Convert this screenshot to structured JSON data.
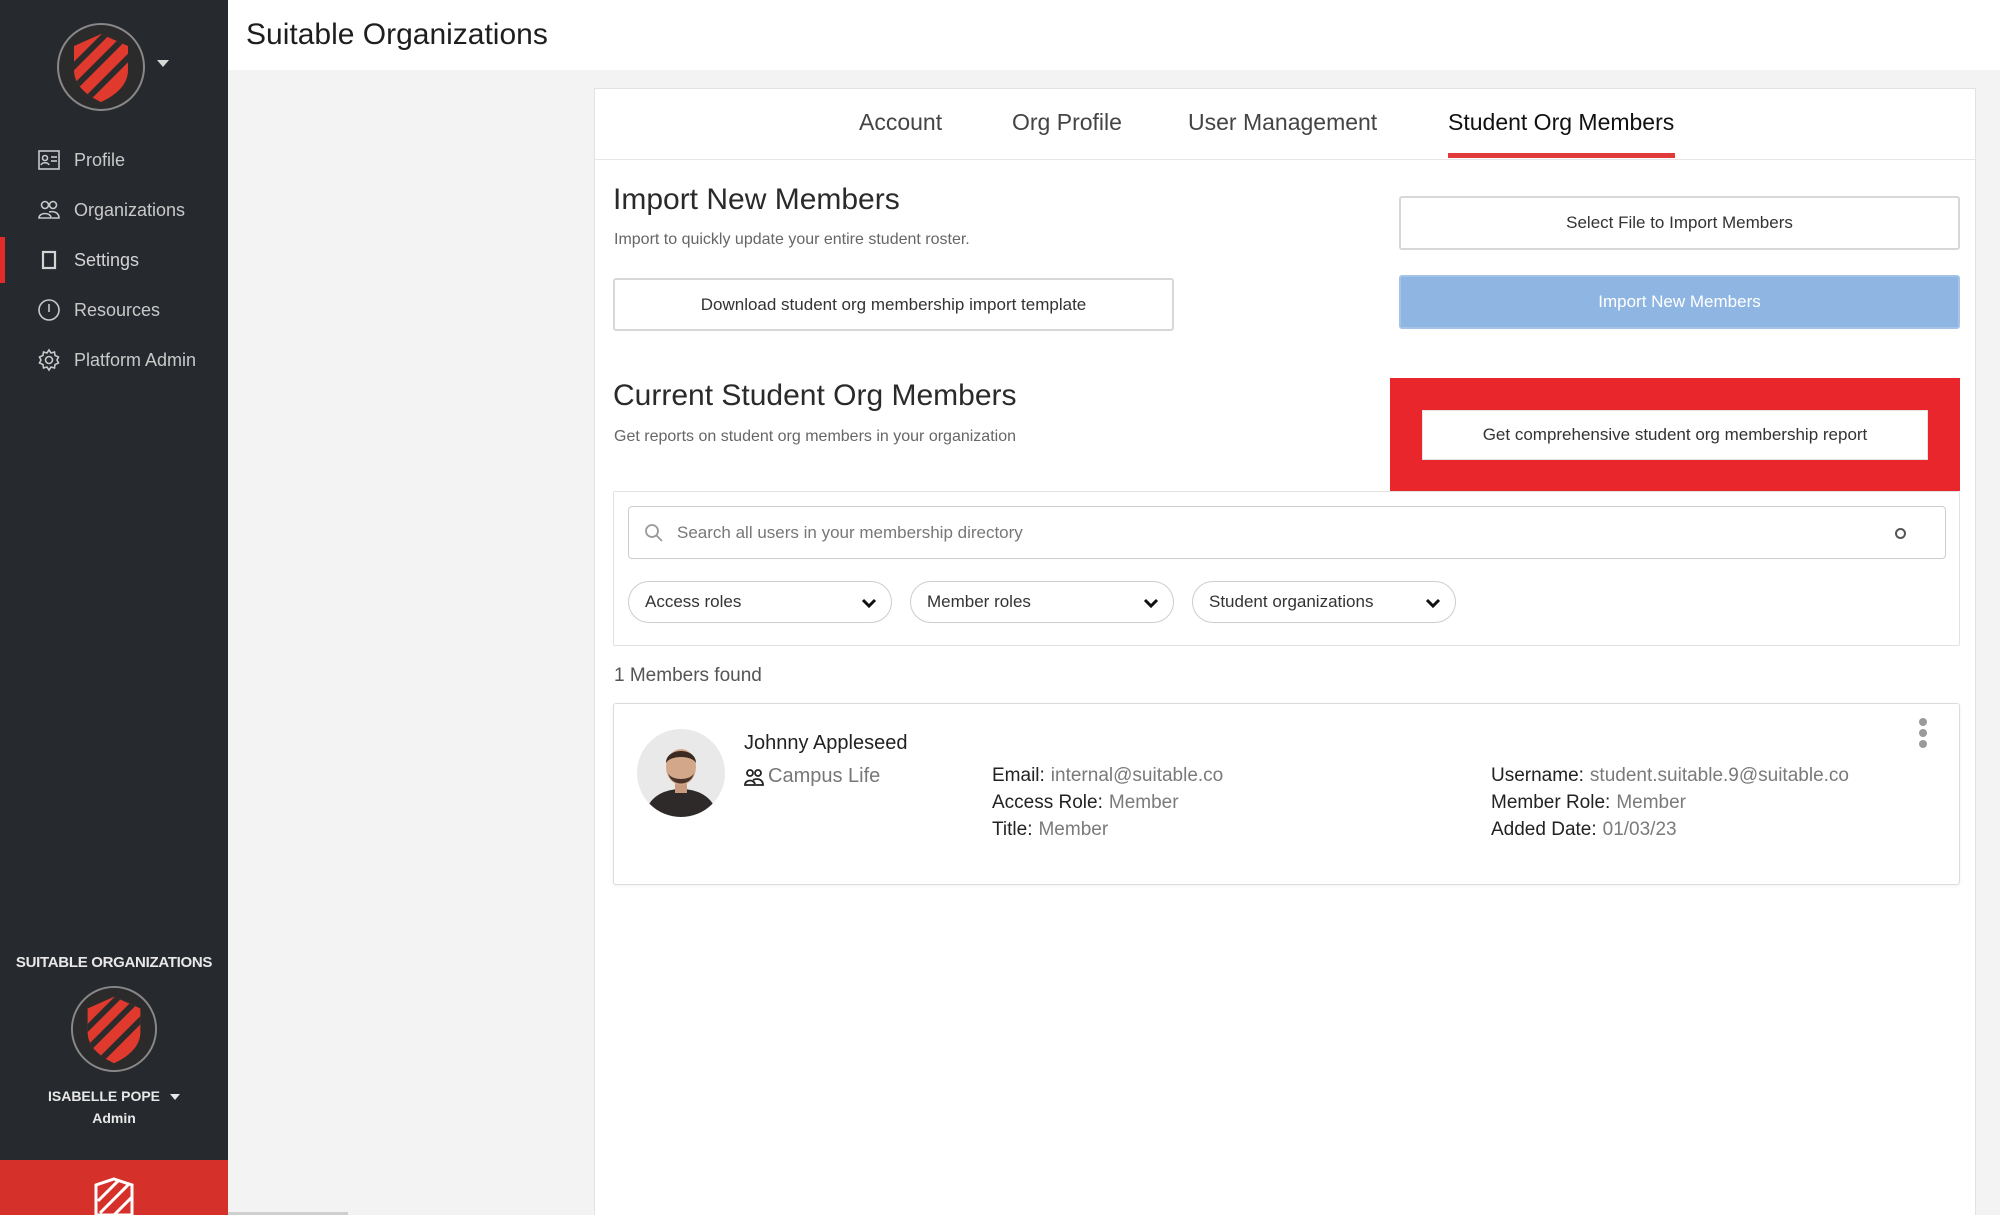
{
  "app": {
    "page_title": "Suitable Organizations",
    "brand_color": "#e32b2b"
  },
  "sidebar": {
    "items": [
      {
        "label": "Profile",
        "icon": "id-card-icon"
      },
      {
        "label": "Organizations",
        "icon": "users-icon"
      },
      {
        "label": "Settings",
        "icon": "settings-square-icon",
        "active": true
      },
      {
        "label": "Resources",
        "icon": "info-circle-icon"
      },
      {
        "label": "Platform Admin",
        "icon": "gear-icon"
      }
    ],
    "org_label": "SUITABLE ORGANIZATIONS",
    "user_name": "ISABELLE POPE",
    "user_role": "Admin"
  },
  "tabs": [
    {
      "label": "Account"
    },
    {
      "label": "Org Profile"
    },
    {
      "label": "User Management"
    },
    {
      "label": "Student Org Members",
      "active": true
    }
  ],
  "import": {
    "title": "Import New Members",
    "subtitle": "Import to quickly update your entire student roster.",
    "template_button": "Download student org membership import template",
    "select_file_button": "Select File to Import Members",
    "import_button": "Import New Members",
    "import_button_color": "#8fb6e3"
  },
  "current": {
    "title": "Current Student Org Members",
    "subtitle": "Get reports on student org members in your organization",
    "report_button": "Get comprehensive student org membership report",
    "highlight_color": "#e8262b"
  },
  "search": {
    "placeholder": "Search all users in your membership directory"
  },
  "filters": [
    {
      "label": "Access roles"
    },
    {
      "label": "Member roles"
    },
    {
      "label": "Student organizations"
    }
  ],
  "results": {
    "count_text": "1 Members found"
  },
  "member": {
    "name": "Johnny Appleseed",
    "org": "Campus Life",
    "email_label": "Email:",
    "email": "internal@suitable.co",
    "access_role_label": "Access Role:",
    "access_role": "Member",
    "title_label": "Title:",
    "title": "Member",
    "username_label": "Username:",
    "username": "student.suitable.9@suitable.co",
    "member_role_label": "Member Role:",
    "member_role": "Member",
    "added_date_label": "Added Date:",
    "added_date": "01/03/23"
  }
}
